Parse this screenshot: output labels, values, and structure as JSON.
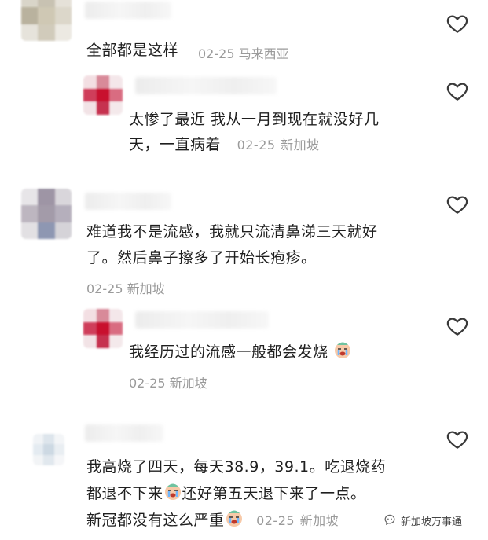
{
  "comments": [
    {
      "text_lines": [
        "全部都是这样"
      ],
      "date": "02-25",
      "location": "马来西亚"
    },
    {
      "text_lines": [
        "太惨了最近 我从一月到现在就没好几",
        "天，一直病着"
      ],
      "date": "02-25",
      "location": "新加坡"
    },
    {
      "text_lines": [
        "难道我不是流感，我就只流清鼻涕三天就好",
        "了。然后鼻子擦多了开始长疱疹。"
      ],
      "date": "02-25",
      "location": "新加坡"
    },
    {
      "text_lines": [
        "我经历过的流感一般都会发烧"
      ],
      "date": "02-25",
      "location": "新加坡"
    },
    {
      "text_lines": [
        "我高烧了四天，每天38.9，39.1。吃退烧药",
        "都退不下来",
        "还好第五天退下来了一点。",
        "新冠都没有这么严重"
      ],
      "date": "02-25",
      "location": "新加坡"
    }
  ],
  "watermark": "新加坡万事通",
  "icons": [
    "heart-icon",
    "crying-face-icon",
    "wechat-channel-icon"
  ]
}
